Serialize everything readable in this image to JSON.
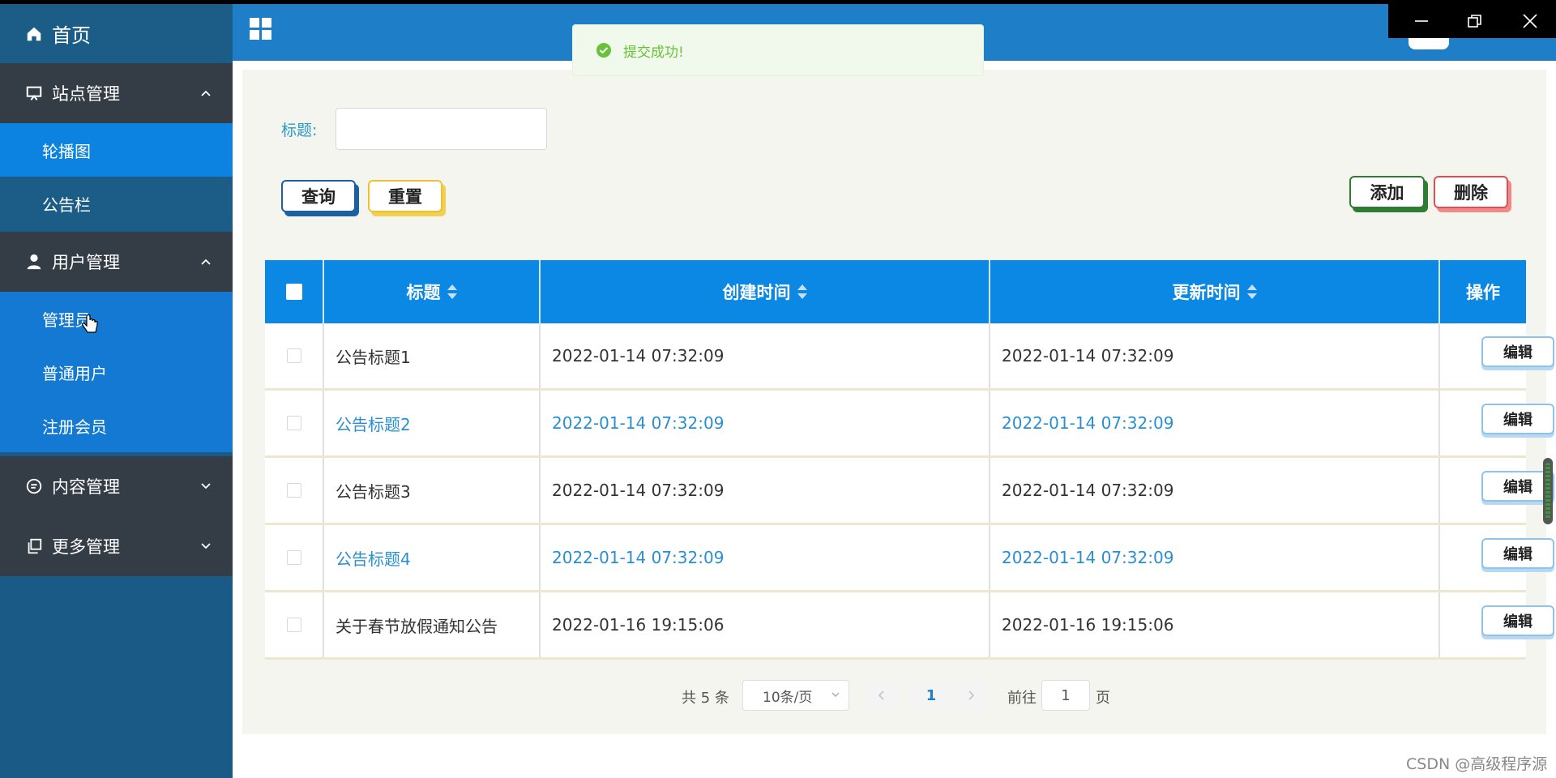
{
  "sidebar": {
    "home": "首页",
    "groups": [
      {
        "label": "站点管理",
        "icon": "monitor-icon",
        "expanded": true,
        "items": [
          "轮播图",
          "公告栏"
        ]
      },
      {
        "label": "用户管理",
        "icon": "user-icon",
        "expanded": true,
        "items": [
          "管理员",
          "普通用户",
          "注册会员"
        ]
      },
      {
        "label": "内容管理",
        "icon": "chat-icon",
        "expanded": false
      },
      {
        "label": "更多管理",
        "icon": "copy-icon",
        "expanded": false
      }
    ]
  },
  "toast": {
    "message": "提交成功!"
  },
  "search": {
    "title_label": "标题:",
    "title_value": ""
  },
  "buttons": {
    "query": "查询",
    "reset": "重置",
    "add": "添加",
    "delete": "删除"
  },
  "table": {
    "columns": [
      "标题",
      "创建时间",
      "更新时间",
      "操作"
    ],
    "rows": [
      {
        "title": "公告标题1",
        "created": "2022-01-14 07:32:09",
        "updated": "2022-01-14 07:32:09"
      },
      {
        "title": "公告标题2",
        "created": "2022-01-14 07:32:09",
        "updated": "2022-01-14 07:32:09"
      },
      {
        "title": "公告标题3",
        "created": "2022-01-14 07:32:09",
        "updated": "2022-01-14 07:32:09"
      },
      {
        "title": "公告标题4",
        "created": "2022-01-14 07:32:09",
        "updated": "2022-01-14 07:32:09"
      },
      {
        "title": "关于春节放假通知公告",
        "created": "2022-01-16 19:15:06",
        "updated": "2022-01-16 19:15:06"
      }
    ],
    "edit_label": "编辑"
  },
  "pagination": {
    "total": "共 5 条",
    "page_size": "10条/页",
    "current": "1",
    "goto": "前往",
    "goto_value": "1",
    "unit": "页"
  },
  "watermark": "CSDN @高级程序源",
  "colors": {
    "sidebar": "#1a5a86",
    "header": "#1e7ec8",
    "table_header": "#0b88e3",
    "link_row": "#2a8fd0"
  }
}
